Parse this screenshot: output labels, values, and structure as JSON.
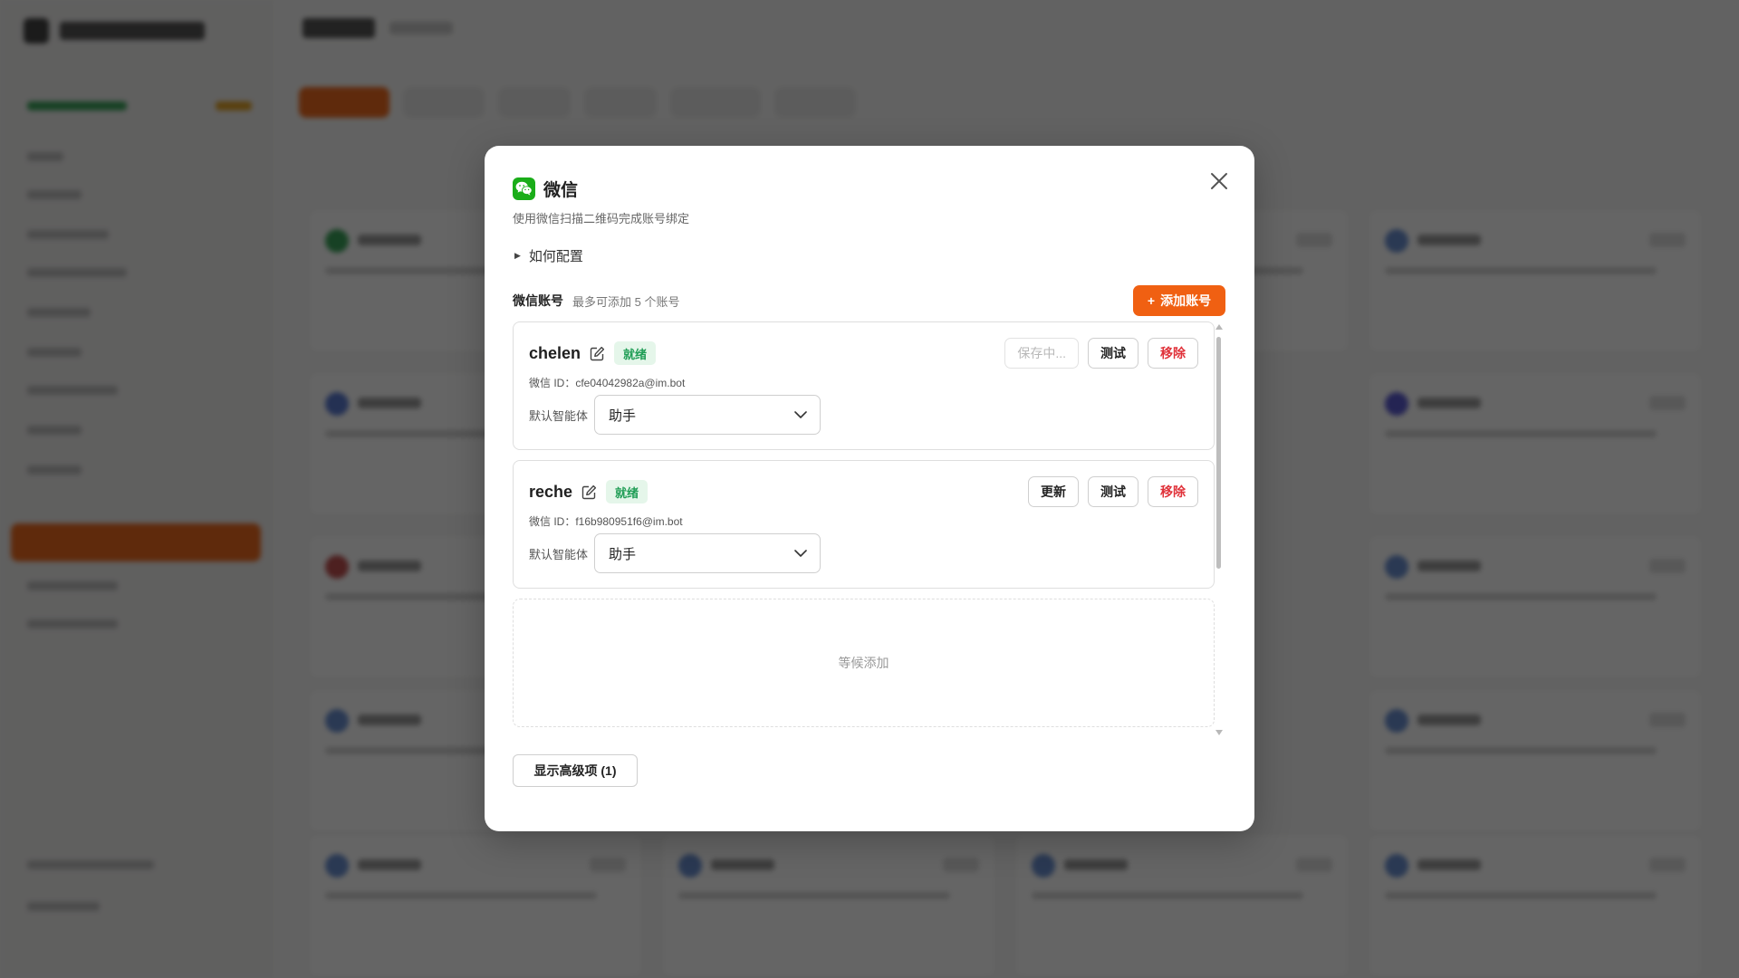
{
  "modal": {
    "title": "微信",
    "description": "使用微信扫描二维码完成账号绑定",
    "how_to_label": "如何配置",
    "section_title": "微信账号",
    "section_hint": "最多可添加 5 个账号",
    "add_button_label": "添加账号",
    "add_button_prefix": "+",
    "empty_slot_text": "等候添加",
    "advanced_button_label": "显示高级项 (1)",
    "accent_color": "#f06012",
    "wechat_color": "#1aad19"
  },
  "accounts": [
    {
      "name": "chelen",
      "status": "就绪",
      "id_label": "微信 ID：",
      "id_value": "cfe04042982a@im.bot",
      "agent_label": "默认智能体",
      "agent_value": "助手",
      "actions": {
        "primary": "保存中...",
        "test": "测试",
        "remove": "移除"
      }
    },
    {
      "name": "reche",
      "status": "就绪",
      "id_label": "微信 ID：",
      "id_value": "f16b980951f6@im.bot",
      "agent_label": "默认智能体",
      "agent_value": "助手",
      "actions": {
        "primary": "更新",
        "test": "测试",
        "remove": "移除"
      }
    }
  ]
}
